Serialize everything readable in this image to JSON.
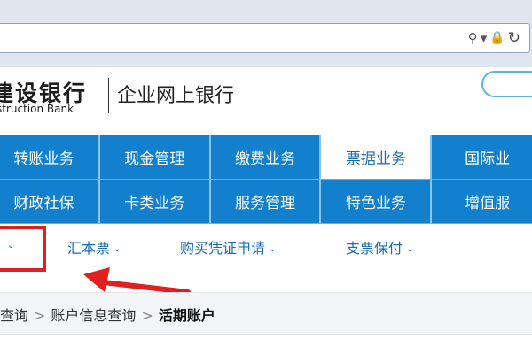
{
  "browser": {
    "icons": [
      "search-icon",
      "dropdown-icon",
      "lock-icon",
      "refresh-icon"
    ],
    "glyphs": {
      "search": "⚲",
      "dropdown": "▾",
      "lock": "🔒",
      "refresh": "↻"
    }
  },
  "header": {
    "bank_name_cn": "建设银行",
    "bank_name_en": "struction Bank",
    "subtitle": "企业网上银行"
  },
  "nav": {
    "row1": [
      "转账业务",
      "现金管理",
      "缴费业务",
      "票据业务",
      "国际业"
    ],
    "row2": [
      "财政社保",
      "卡类业务",
      "服务管理",
      "特色业务",
      "增值服"
    ],
    "active": "票据业务",
    "colors": {
      "bar": "#1380cd",
      "active_bg": "#ffffff",
      "active_text": "#1a6cb0"
    }
  },
  "submenu": {
    "items": [
      "汇本票",
      "购买凭证申请",
      "支票保付"
    ],
    "chevron": "⌄",
    "highlight_color": "#e02020"
  },
  "breadcrumb": {
    "items": [
      "查询",
      "账户信息查询"
    ],
    "current": "活期账户",
    "separator": ">"
  }
}
